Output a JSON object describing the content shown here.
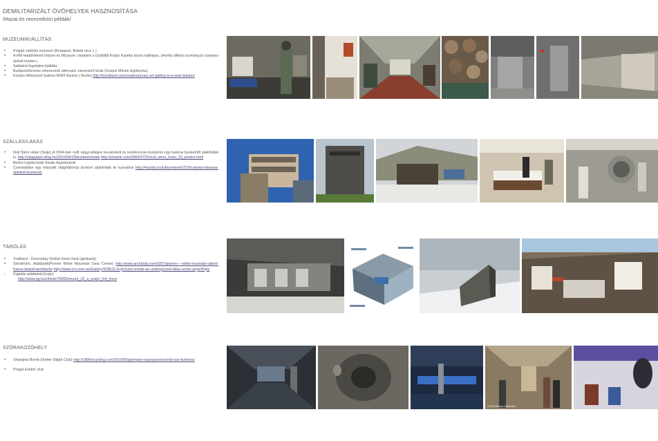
{
  "title": "DEMILITARIZÁLT ÖVÖHELYEK HASZNOSÍTÁSA",
  "subtitle": "/Hazai és nemzetközi példák/",
  "sections": [
    {
      "heading": "MÚZEUM/KIÁLLÍTÁS",
      "items": [
        "Polgári védelmi múzeum (Budapest, Bebek utca 1.)",
        "A HM Hadtörténeti Intézet és Múzeum, valamint a Gödöllői Királyi Kastély közös kiállítása. (Horthy Miklós kormányzó számára épített bunker.)",
        "Sziklakói légoltalmi kiállítás",
        " BudapestScenes elnevezésű alternatív városnéző túrák (Csepel Művek légókocka)"
      ],
      "item5_text": "Kortárs Művészeti Galéria WWII Bunker ( Berlin) ",
      "item5_link": "http://trendland.com/contemporary-art-gallery-in-a-wwii-bunker/"
    },
    {
      "heading": "SZÁLLÁS/LAKÁS",
      "item1_text": "Null Stern Hotel (Svájc) A 2004-ben nyílt négycsillagos luxushotelt és konferencia központot egy katonai bunkerből alakították ki. ",
      "item1_link1": "http://vilagutazo.blog.hu/2010/06/23/bunkerhotelek",
      "item1_link2": "http://izismile.com/2009/07/15/null_stern_hotel_20_photos.html",
      "item2": "Berlini Légókockák Studio Apartmanok",
      "item3_text": "Cornwallban egy második világháborús bunkert alakítottak át nyaralóvá ",
      "item3_link": "http://4szoba.hu/cikk/enteriör/2109-atomio-lakassa-alakitott-bunkerek"
    },
    {
      "heading": "TÁROLÁS",
      "item1": "Svalbard - Doomsday Global Seed Vault (génbank)",
      "item2_text": "Stockholm, Adatbank(Pionen White Mountain Data Center) ",
      "item2_link1": "http://www.archdaily.com/9257/pionen----white-mountain-albert-france-lanord-architects/",
      "item2_link2": "http://www.crn.com.au/Gallery/329622,in-pictures-inside-an-underground-data-centre.aspx/4#pic",
      "item3": "Digitális adatbank(Svájc)",
      "item3_link": "http://www.sg.hu/cikkek/78369/mount_10_a_svajci_fort_knox"
    },
    {
      "heading": "SZÓRAKOZÓHELY",
      "item1_text": "Shanghai Bomb Shelter (Night Club) ",
      "item1_link": "http://1800recycling.com/2010/09/germany-repurposed-world-war-bunkers/",
      "item2": "Prágai bunker club"
    }
  ],
  "photo_credit": "© DR/Vittorio Maiorano",
  "colors": {
    "text": "#4a4a4a",
    "link": "#4a4a78",
    "background": "#ffffff"
  }
}
